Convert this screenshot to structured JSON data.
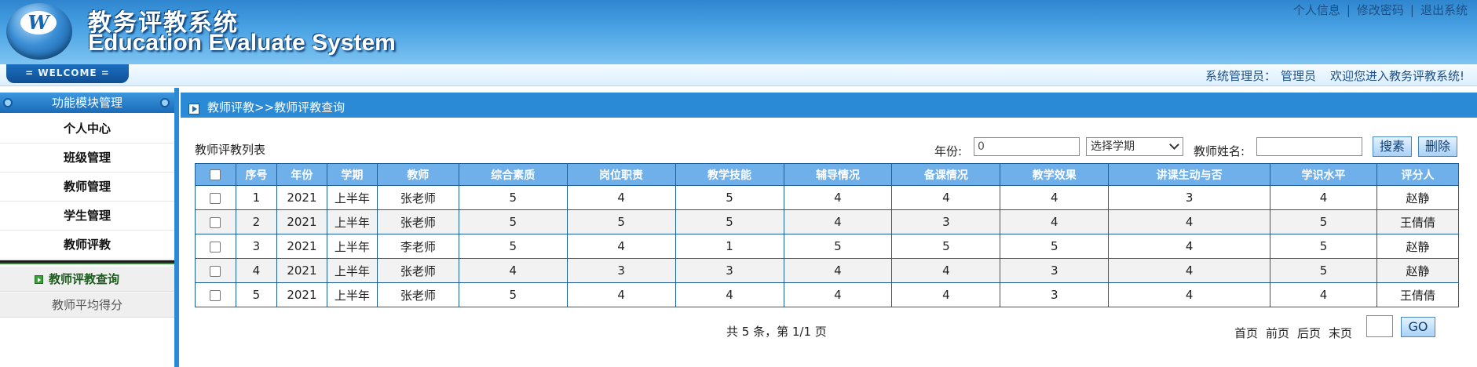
{
  "header": {
    "title_cn": "教务评教系统",
    "title_en": "Education Evaluate System",
    "logo_letter": "W",
    "links": [
      "个人信息",
      "修改密码",
      "退出系统"
    ],
    "separator": "|"
  },
  "welcome": {
    "tab_label": "= WELCOME =",
    "role_label": "系统管理员：",
    "user_name": "管理员",
    "message": "欢迎您进入教务评教系统!"
  },
  "sidebar": {
    "title": "功能模块管理",
    "items": [
      "个人中心",
      "班级管理",
      "教师管理",
      "学生管理",
      "教师评教"
    ],
    "sub_items": [
      "教师评教查询",
      "教师平均得分"
    ]
  },
  "breadcrumb": "教师评教>>教师评教查询",
  "filters": {
    "list_title": "教师评教列表",
    "year_label": "年份:",
    "year_value": "0",
    "term_select": "选择学期",
    "teacher_label": "教师姓名:",
    "teacher_value": "",
    "search_button": "搜素",
    "delete_button": "删除"
  },
  "table": {
    "headers": [
      "序号",
      "年份",
      "学期",
      "教师",
      "综合素质",
      "岗位职责",
      "教学技能",
      "辅导情况",
      "备课情况",
      "教学效果",
      "讲课生动与否",
      "学识水平",
      "评分人"
    ],
    "rows": [
      [
        "1",
        "2021",
        "上半年",
        "张老师",
        "5",
        "4",
        "5",
        "4",
        "4",
        "4",
        "3",
        "4",
        "赵静"
      ],
      [
        "2",
        "2021",
        "上半年",
        "张老师",
        "5",
        "5",
        "5",
        "4",
        "3",
        "4",
        "4",
        "5",
        "王倩倩"
      ],
      [
        "3",
        "2021",
        "上半年",
        "李老师",
        "5",
        "4",
        "1",
        "5",
        "5",
        "5",
        "4",
        "5",
        "赵静"
      ],
      [
        "4",
        "2021",
        "上半年",
        "张老师",
        "4",
        "3",
        "3",
        "4",
        "4",
        "3",
        "4",
        "5",
        "赵静"
      ],
      [
        "5",
        "2021",
        "上半年",
        "张老师",
        "5",
        "4",
        "4",
        "4",
        "4",
        "3",
        "4",
        "4",
        "王倩倩"
      ]
    ]
  },
  "pager": {
    "info": "共 5 条，第 1/1 页",
    "links": [
      "首页",
      "前页",
      "后页",
      "末页"
    ],
    "go_label": "GO"
  }
}
